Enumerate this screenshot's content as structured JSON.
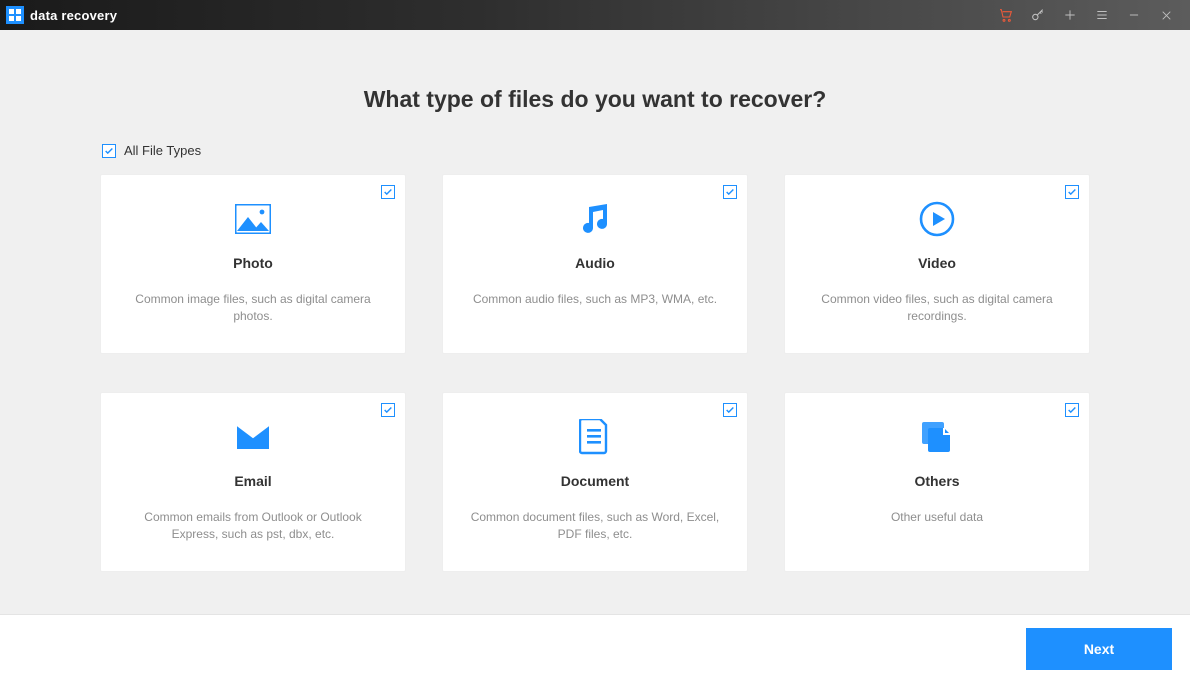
{
  "colors": {
    "accent": "#1e90ff",
    "titlebar_bg": "#2e2e2e",
    "cart": "#ee5a3a"
  },
  "titlebar": {
    "app_title": "data recovery",
    "icons": {
      "cart": "cart-icon",
      "key": "key-icon",
      "plus": "plus-icon",
      "menu": "menu-icon",
      "minimize": "minimize-icon",
      "close": "close-icon"
    }
  },
  "heading": "What type of files do you want to recover?",
  "all_checkbox": {
    "label": "All File Types",
    "checked": true
  },
  "cards": [
    {
      "key": "photo",
      "title": "Photo",
      "desc": "Common image files, such as digital camera photos.",
      "checked": true,
      "icon": "photo-icon"
    },
    {
      "key": "audio",
      "title": "Audio",
      "desc": "Common audio files, such as MP3, WMA, etc.",
      "checked": true,
      "icon": "audio-icon"
    },
    {
      "key": "video",
      "title": "Video",
      "desc": "Common video files, such as digital camera recordings.",
      "checked": true,
      "icon": "video-icon"
    },
    {
      "key": "email",
      "title": "Email",
      "desc": "Common emails from Outlook or Outlook Express, such as pst, dbx, etc.",
      "checked": true,
      "icon": "email-icon"
    },
    {
      "key": "document",
      "title": "Document",
      "desc": "Common document files, such as Word, Excel, PDF files, etc.",
      "checked": true,
      "icon": "document-icon"
    },
    {
      "key": "others",
      "title": "Others",
      "desc": "Other useful data",
      "checked": true,
      "icon": "others-icon"
    }
  ],
  "footer": {
    "next_label": "Next"
  }
}
